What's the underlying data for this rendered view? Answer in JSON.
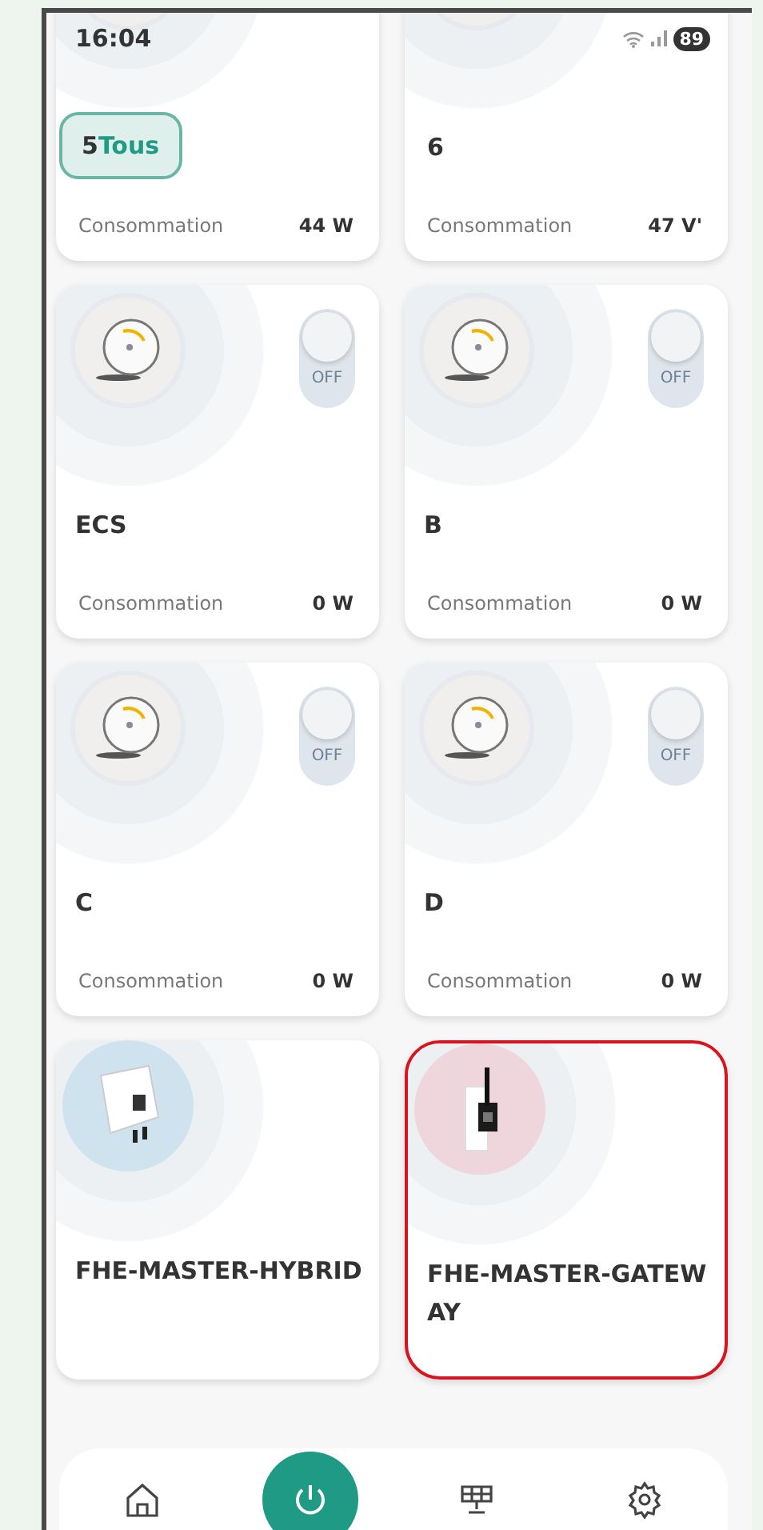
{
  "status_bar": {
    "time": "16:04",
    "battery": "89"
  },
  "cards": [
    {
      "kind": "group",
      "title": "5",
      "chip": "Tous",
      "chip_selected": true,
      "label": "Consommation",
      "value": "44 W",
      "highlighted": false
    },
    {
      "kind": "group",
      "title": "6",
      "label": "Consommation",
      "value": "47 V'",
      "highlighted": false
    },
    {
      "kind": "thermostat",
      "title": "ECS",
      "toggle": {
        "on": false,
        "text": "OFF"
      },
      "label": "Consommation",
      "value": "0 W",
      "highlighted": false
    },
    {
      "kind": "thermostat",
      "title": "B",
      "toggle": {
        "on": false,
        "text": "OFF"
      },
      "label": "Consommation",
      "value": "0 W",
      "highlighted": false
    },
    {
      "kind": "thermostat",
      "title": "C",
      "toggle": {
        "on": false,
        "text": "OFF"
      },
      "label": "Consommation",
      "value": "0 W",
      "highlighted": false
    },
    {
      "kind": "thermostat",
      "title": "D",
      "toggle": {
        "on": false,
        "text": "OFF"
      },
      "label": "Consommation",
      "value": "0 W",
      "highlighted": false
    },
    {
      "kind": "inverter",
      "title": "FHE-MASTER-HYBRID",
      "highlighted": false
    },
    {
      "kind": "gateway",
      "title": "FHE-MASTER-GATEW AY",
      "highlighted": true
    }
  ],
  "nav": [
    {
      "kind": "home",
      "selected": false
    },
    {
      "kind": "power",
      "selected": true
    },
    {
      "kind": "solar",
      "selected": false
    },
    {
      "kind": "settings",
      "selected": false
    }
  ]
}
